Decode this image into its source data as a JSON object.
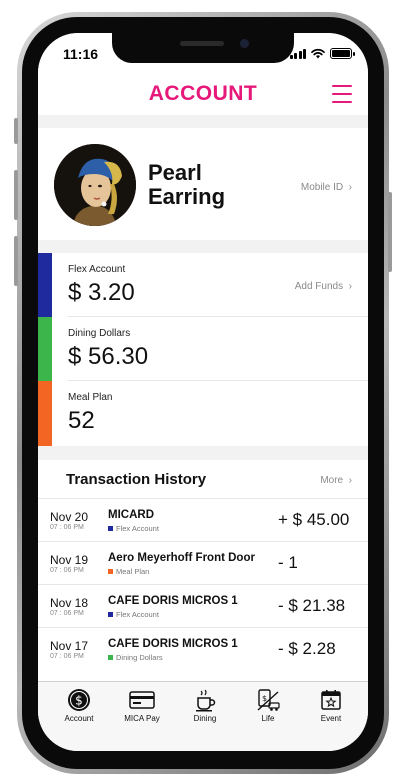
{
  "status_bar": {
    "time": "11:16"
  },
  "header": {
    "title": "ACCOUNT"
  },
  "profile": {
    "first_name": "Pearl",
    "last_name": "Earring",
    "mobile_id_link": "Mobile ID"
  },
  "balances": [
    {
      "label": "Flex Account",
      "value": "$ 3.20",
      "action": "Add Funds",
      "color": "#1e2a9e"
    },
    {
      "label": "Dining Dollars",
      "value": "$ 56.30",
      "color": "#3cb54a"
    },
    {
      "label": "Meal Plan",
      "value": "52",
      "color": "#f26522"
    }
  ],
  "transactions": {
    "title": "Transaction History",
    "more_link": "More",
    "items": [
      {
        "date": "Nov 20",
        "time": "07 : 06 PM",
        "merchant": "MICARD",
        "account": "Flex Account",
        "account_color": "#1e2a9e",
        "amount": "+ $ 45.00"
      },
      {
        "date": "Nov 19",
        "time": "07 : 06 PM",
        "merchant": "Aero Meyerhoff Front Door",
        "account": "Meal Plan",
        "account_color": "#f26522",
        "amount": "- 1"
      },
      {
        "date": "Nov 18",
        "time": "07 : 06 PM",
        "merchant": "CAFE DORIS MICROS 1",
        "account": "Flex Account",
        "account_color": "#1e2a9e",
        "amount": "- $ 21.38"
      },
      {
        "date": "Nov 17",
        "time": "07 : 06 PM",
        "merchant": "CAFE DORIS MICROS 1",
        "account": "Dining Dollars",
        "account_color": "#3cb54a",
        "amount": "- $ 2.28"
      }
    ]
  },
  "tabbar": {
    "tabs": [
      {
        "label": "Account",
        "icon": "dollar-coin-icon"
      },
      {
        "label": "MICA Pay",
        "icon": "card-icon"
      },
      {
        "label": "Dining",
        "icon": "coffee-cup-icon"
      },
      {
        "label": "Life",
        "icon": "life-icon"
      },
      {
        "label": "Event",
        "icon": "calendar-star-icon"
      }
    ]
  },
  "colors": {
    "accent": "#e6197a",
    "flex": "#1e2a9e",
    "dining": "#3cb54a",
    "meal": "#f26522"
  }
}
